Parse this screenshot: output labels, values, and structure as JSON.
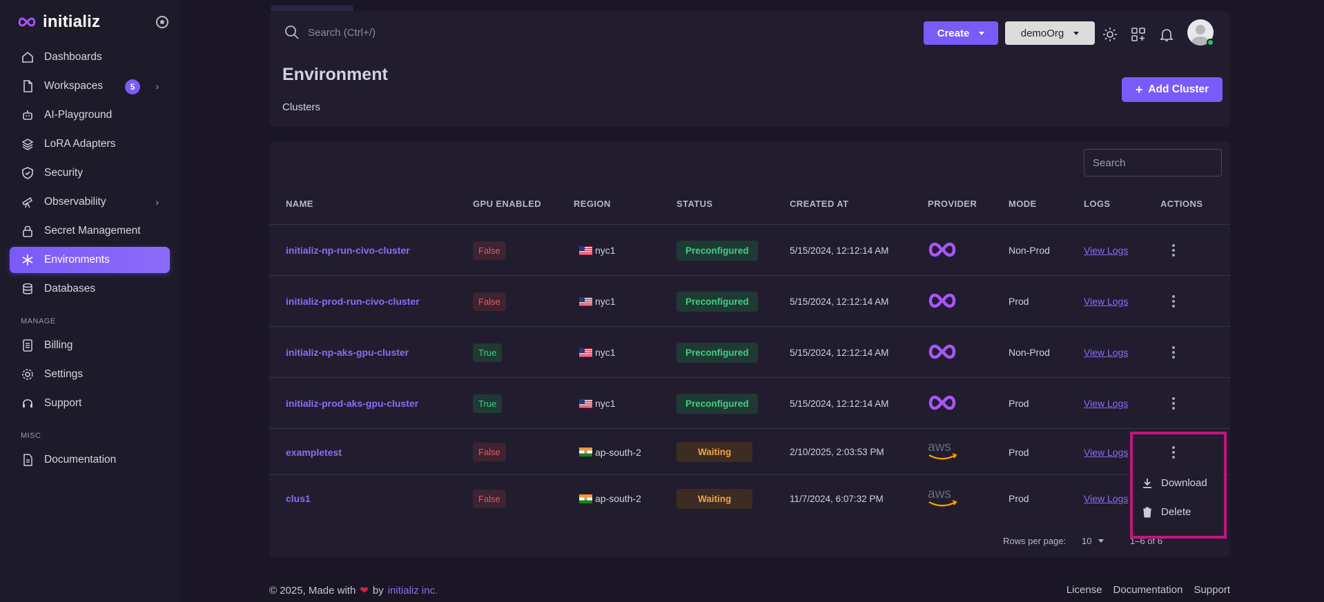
{
  "app": {
    "name": "initializ"
  },
  "sidebar": {
    "items": [
      {
        "label": "Dashboards",
        "icon": "home-icon"
      },
      {
        "label": "Workspaces",
        "icon": "file-icon",
        "badge": "5"
      },
      {
        "label": "AI-Playground",
        "icon": "robot-icon"
      },
      {
        "label": "LoRA Adapters",
        "icon": "layers-icon"
      },
      {
        "label": "Security",
        "icon": "shield-icon"
      },
      {
        "label": "Observability",
        "icon": "telescope-icon"
      },
      {
        "label": "Secret Management",
        "icon": "lock-icon"
      },
      {
        "label": "Environments",
        "icon": "snowflake-icon"
      },
      {
        "label": "Databases",
        "icon": "database-icon"
      }
    ],
    "manage_label": "MANAGE",
    "manage_items": [
      {
        "label": "Billing",
        "icon": "receipt-icon"
      },
      {
        "label": "Settings",
        "icon": "gear-icon"
      },
      {
        "label": "Support",
        "icon": "headset-icon"
      }
    ],
    "misc_label": "MISC",
    "misc_items": [
      {
        "label": "Documentation",
        "icon": "document-icon"
      }
    ]
  },
  "header": {
    "search_placeholder": "Search (Ctrl+/)",
    "create_label": "Create",
    "org_label": "demoOrg",
    "title": "Environment",
    "subtitle": "Clusters",
    "add_cluster_label": "Add Cluster"
  },
  "table": {
    "search_placeholder": "Search",
    "columns": [
      "NAME",
      "GPU ENABLED",
      "REGION",
      "STATUS",
      "CREATED AT",
      "PROVIDER",
      "MODE",
      "LOGS",
      "ACTIONS"
    ],
    "rows": [
      {
        "name": "initializ-np-run-civo-cluster",
        "gpu": "False",
        "flag": "us",
        "region": "nyc1",
        "status": "Preconfigured",
        "created": "5/15/2024, 12:12:14 AM",
        "provider": "initializ",
        "mode": "Non-Prod",
        "logs": "View Logs"
      },
      {
        "name": "initializ-prod-run-civo-cluster",
        "gpu": "False",
        "flag": "us",
        "region": "nyc1",
        "status": "Preconfigured",
        "created": "5/15/2024, 12:12:14 AM",
        "provider": "initializ",
        "mode": "Prod",
        "logs": "View Logs"
      },
      {
        "name": "initializ-np-aks-gpu-cluster",
        "gpu": "True",
        "flag": "us",
        "region": "nyc1",
        "status": "Preconfigured",
        "created": "5/15/2024, 12:12:14 AM",
        "provider": "initializ",
        "mode": "Non-Prod",
        "logs": "View Logs"
      },
      {
        "name": "initializ-prod-aks-gpu-cluster",
        "gpu": "True",
        "flag": "us",
        "region": "nyc1",
        "status": "Preconfigured",
        "created": "5/15/2024, 12:12:14 AM",
        "provider": "initializ",
        "mode": "Prod",
        "logs": "View Logs"
      },
      {
        "name": "exampletest",
        "gpu": "False",
        "flag": "in",
        "region": "ap-south-2",
        "status": "Waiting",
        "created": "2/10/2025, 2:03:53 PM",
        "provider": "aws",
        "mode": "Prod",
        "logs": "View Logs"
      },
      {
        "name": "clus1",
        "gpu": "False",
        "flag": "in",
        "region": "ap-south-2",
        "status": "Waiting",
        "created": "11/7/2024, 6:07:32 PM",
        "provider": "aws",
        "mode": "Prod",
        "logs": "View Logs"
      }
    ],
    "rows_per_page_label": "Rows per page:",
    "rows_per_page_value": "10",
    "pagination": "1–6 of 6"
  },
  "action_menu": {
    "download_label": "Download",
    "delete_label": "Delete"
  },
  "footer": {
    "copyright": "© 2025, Made with",
    "by": "by",
    "company": "initializ inc.",
    "links": [
      "License",
      "Documentation",
      "Support"
    ]
  },
  "colors": {
    "accent": "#7a5af8",
    "link": "#8b6cf9",
    "highlight": "#c0177b"
  }
}
